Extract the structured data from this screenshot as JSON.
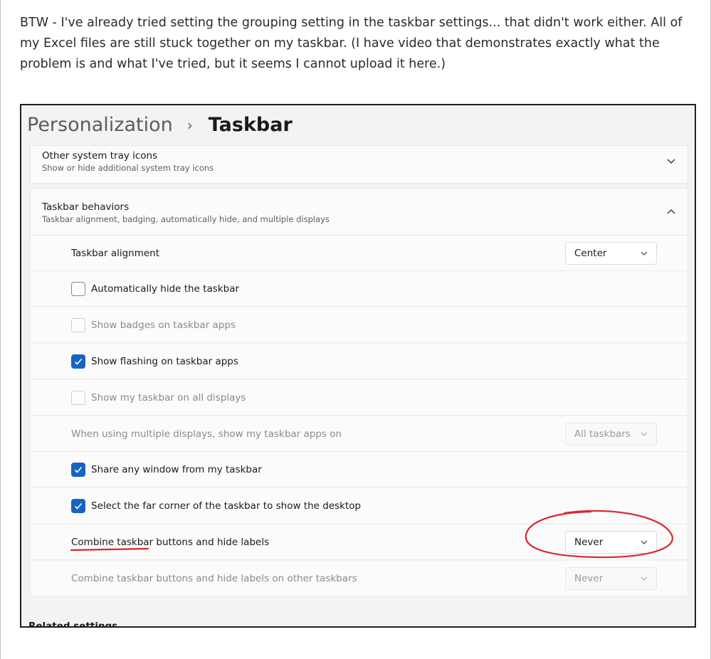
{
  "post": {
    "text": "BTW - I've already tried setting the grouping setting in the taskbar settings... that didn't work either.  All of my Excel files are still stuck together on my taskbar.   (I have video that demonstrates exactly what the problem is and what I've tried, but it seems I cannot upload it here.)"
  },
  "header": {
    "parent": "Personalization",
    "separator": "›",
    "current": "Taskbar"
  },
  "sections": {
    "tray": {
      "title": "Other system tray icons",
      "subtitle": "Show or hide additional system tray icons"
    },
    "behaviors": {
      "title": "Taskbar behaviors",
      "subtitle": "Taskbar alignment, badging, automatically hide, and multiple displays"
    }
  },
  "rows": {
    "alignment": {
      "label": "Taskbar alignment",
      "value": "Center"
    },
    "autohide": {
      "label": "Automatically hide the taskbar",
      "checked": false
    },
    "badges": {
      "label": "Show badges on taskbar apps",
      "checked": false,
      "disabled": true
    },
    "flashing": {
      "label": "Show flashing on taskbar apps",
      "checked": true
    },
    "all_displays": {
      "label": "Show my taskbar on all displays",
      "checked": false,
      "disabled": true
    },
    "multi_display": {
      "label": "When using multiple displays, show my taskbar apps on",
      "value": "All taskbars",
      "disabled": true
    },
    "share_window": {
      "label": "Share any window from my taskbar",
      "checked": true
    },
    "far_corner": {
      "label": "Select the far corner of the taskbar to show the desktop",
      "checked": true
    },
    "combine": {
      "label": "Combine taskbar buttons and hide labels",
      "value": "Never"
    },
    "combine_other": {
      "label": "Combine taskbar buttons and hide labels on other taskbars",
      "value": "Never",
      "disabled": true
    }
  },
  "related": {
    "label": "Related settings"
  },
  "colors": {
    "accent": "#1664c2",
    "annotation": "#d9262c"
  }
}
